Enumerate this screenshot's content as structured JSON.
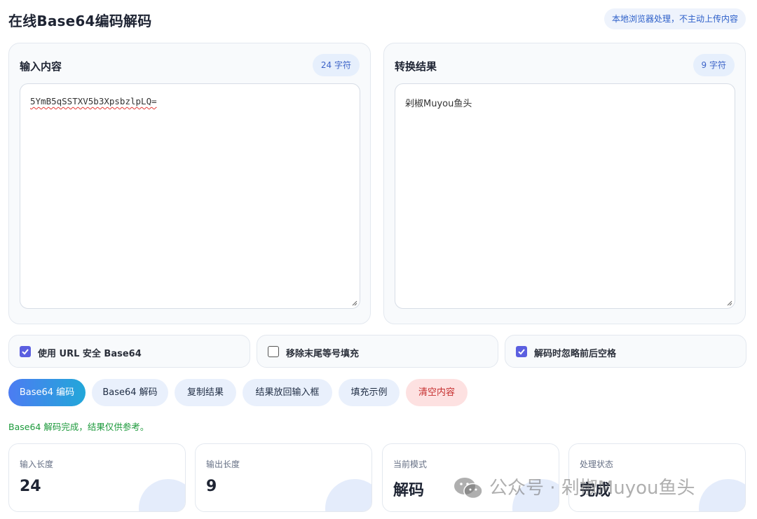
{
  "header": {
    "title": "在线Base64编码解码",
    "notice": "本地浏览器处理，不主动上传内容"
  },
  "input_panel": {
    "title": "输入内容",
    "count": "24 字符",
    "value": "5YmB5qSSTXV5b3XpsbzlpLQ="
  },
  "output_panel": {
    "title": "转换结果",
    "count": "9 字符",
    "value": "剁椒Muyou鱼头"
  },
  "options": [
    {
      "label": "使用 URL 安全 Base64",
      "checked": true
    },
    {
      "label": "移除末尾等号填充",
      "checked": false
    },
    {
      "label": "解码时忽略前后空格",
      "checked": true
    }
  ],
  "buttons": {
    "encode": "Base64 编码",
    "decode": "Base64 解码",
    "copy": "复制结果",
    "swap": "结果放回输入框",
    "sample": "填充示例",
    "clear": "清空内容"
  },
  "status_message": "Base64 解码完成，结果仅供参考。",
  "stats": [
    {
      "label": "输入长度",
      "value": "24"
    },
    {
      "label": "输出长度",
      "value": "9"
    },
    {
      "label": "当前模式",
      "value": "解码"
    },
    {
      "label": "处理状态",
      "value": "完成"
    }
  ],
  "watermark": "公众号 · 剁椒Muyou鱼头",
  "colors": {
    "accent": "#5b5fe0",
    "primary_gradient_start": "#4c7cf2",
    "primary_gradient_end": "#22a7d9",
    "success": "#1d9a3c",
    "danger": "#c62f2f"
  }
}
